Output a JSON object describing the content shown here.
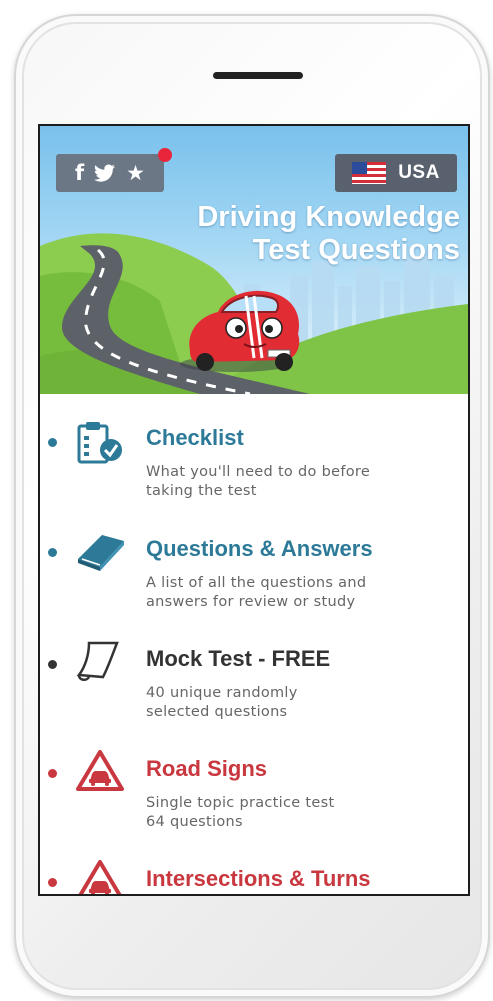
{
  "header": {
    "social_icons": [
      "facebook-icon",
      "twitter-icon",
      "star-icon"
    ],
    "country": "USA",
    "title_line1": "Driving Knowledge",
    "title_line2": "Test Questions"
  },
  "colors": {
    "teal": "#2c7a98",
    "dark": "#333333",
    "red": "#c9373f",
    "sky": "#79c1ec",
    "notification": "#e8253a"
  },
  "menu": {
    "items": [
      {
        "title": "Checklist",
        "desc_line1": "What you'll need to do before",
        "desc_line2": "taking the test",
        "icon": "clipboard-check-icon"
      },
      {
        "title": "Questions & Answers",
        "desc_line1": "A list of all the questions and",
        "desc_line2": "answers for review or study",
        "icon": "book-icon"
      },
      {
        "title": "Mock Test - FREE",
        "desc_line1": "40 unique randomly",
        "desc_line2": "selected questions",
        "icon": "paper-sheet-icon"
      },
      {
        "title": "Road Signs",
        "desc_line1": "Single topic practice test",
        "desc_line2": "64 questions",
        "icon": "warning-car-icon"
      },
      {
        "title": "Intersections & Turns",
        "desc_line1": "",
        "desc_line2": "",
        "icon": "warning-car-icon"
      }
    ]
  }
}
